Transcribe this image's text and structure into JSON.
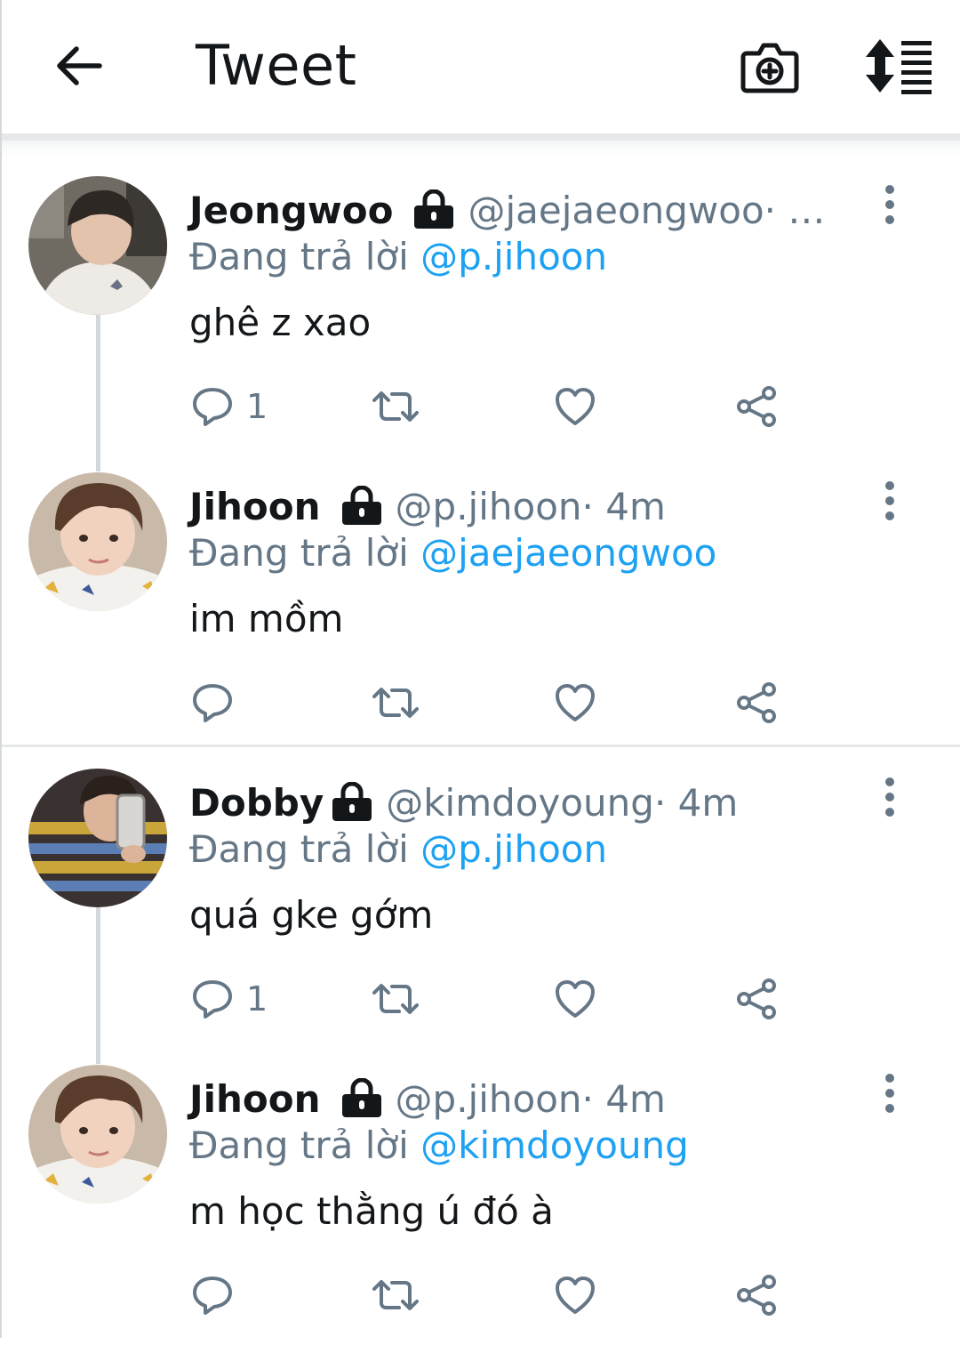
{
  "header": {
    "title": "Tweet",
    "back_icon": "arrow-left-icon",
    "camera_icon": "camera-add-icon",
    "sort_icon": "sort-icon"
  },
  "colors": {
    "link": "#1da1f2",
    "secondary_text": "#657786",
    "primary_text": "#14171a",
    "divider": "#e6e8ea"
  },
  "tweets": [
    {
      "name": "Jeongwoo",
      "handle": "@jaejaeongwoo",
      "time": " · …",
      "reply_prefix": "Đang trả lời ",
      "reply_to": "@p.jihoon",
      "text": "ghê z xao",
      "reply_count": "1",
      "protected": true
    },
    {
      "name": "Jihoon",
      "handle": "@p.jihoon",
      "time": " · 4m",
      "reply_prefix": "Đang trả lời ",
      "reply_to": "@jaejaeongwoo",
      "text": "im mồm",
      "reply_count": "",
      "protected": true
    },
    {
      "name": "Dobby",
      "handle": "@kimdoyoung",
      "time": " · 4m",
      "reply_prefix": "Đang trả lời ",
      "reply_to": "@p.jihoon",
      "text": "quá gke gớm",
      "reply_count": "1",
      "protected": true
    },
    {
      "name": "Jihoon",
      "handle": "@p.jihoon",
      "time": " · 4m",
      "reply_prefix": "Đang trả lời ",
      "reply_to": "@kimdoyoung",
      "text": "m học thằng ú đó à",
      "reply_count": "",
      "protected": true
    }
  ]
}
